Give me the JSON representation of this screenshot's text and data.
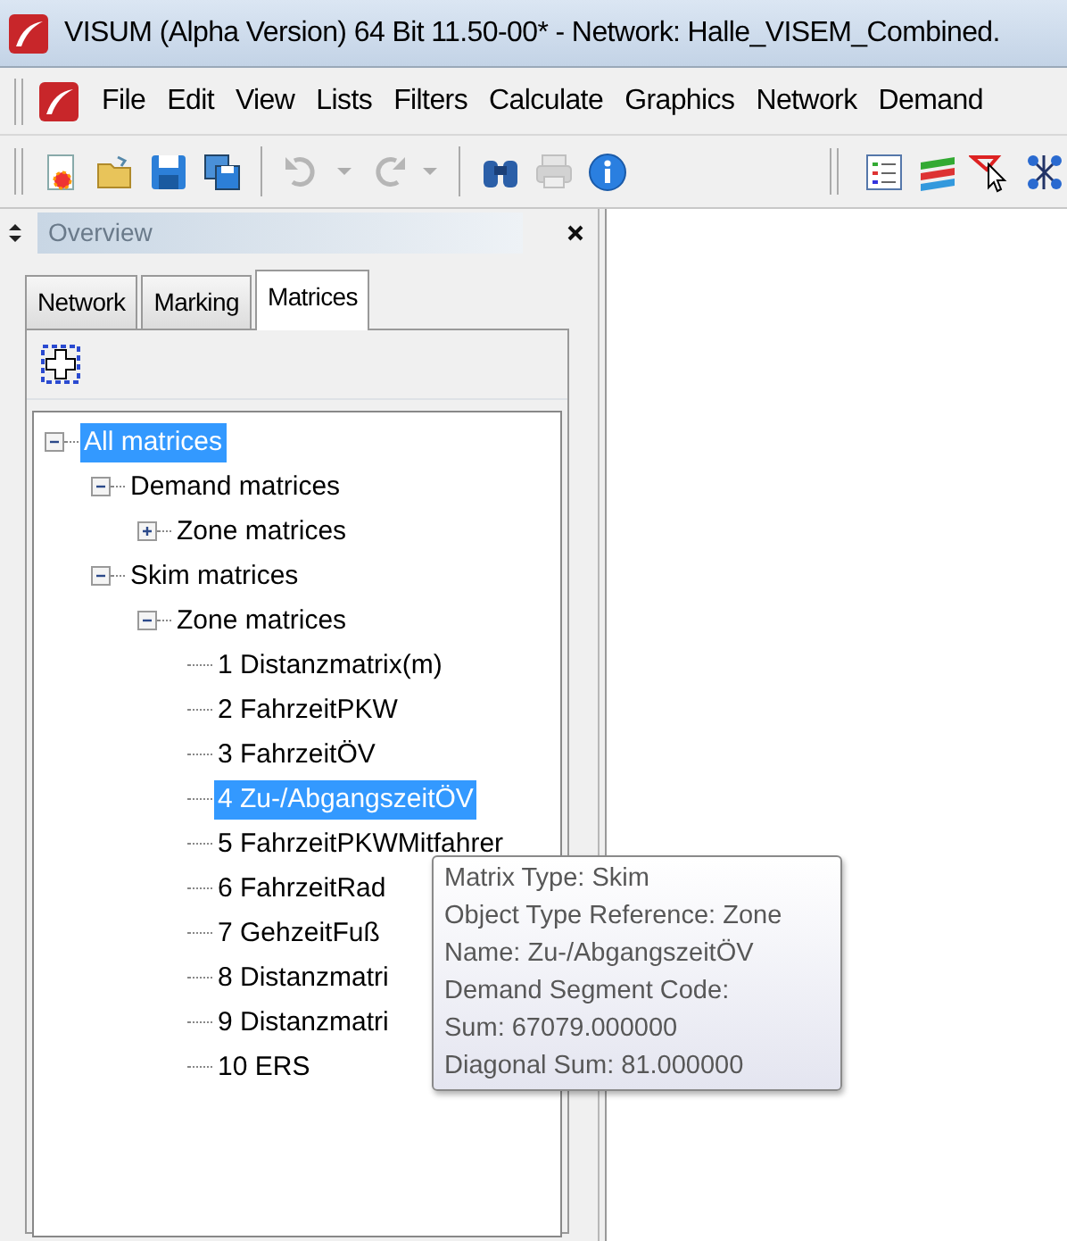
{
  "window": {
    "title": "VISUM (Alpha Version) 64 Bit 11.50-00* - Network: Halle_VISEM_Combined."
  },
  "menu": [
    {
      "label": "File"
    },
    {
      "label": "Edit"
    },
    {
      "label": "View"
    },
    {
      "label": "Lists"
    },
    {
      "label": "Filters"
    },
    {
      "label": "Calculate"
    },
    {
      "label": "Graphics"
    },
    {
      "label": "Network"
    },
    {
      "label": "Demand"
    }
  ],
  "toolbar": [
    {
      "kind": "new",
      "disabled": false
    },
    {
      "kind": "open",
      "disabled": false
    },
    {
      "kind": "save",
      "disabled": false
    },
    {
      "kind": "saveall",
      "disabled": false
    },
    {
      "kind": "sep"
    },
    {
      "kind": "undo",
      "disabled": true
    },
    {
      "kind": "caret",
      "disabled": true
    },
    {
      "kind": "redo",
      "disabled": true
    },
    {
      "kind": "caret",
      "disabled": true
    },
    {
      "kind": "sep"
    },
    {
      "kind": "find",
      "disabled": false
    },
    {
      "kind": "print",
      "disabled": true
    },
    {
      "kind": "info",
      "disabled": false
    },
    {
      "kind": "grip"
    },
    {
      "kind": "list",
      "disabled": false
    },
    {
      "kind": "layers",
      "disabled": false
    },
    {
      "kind": "filter",
      "disabled": false
    },
    {
      "kind": "graph",
      "disabled": false
    }
  ],
  "panel": {
    "title": "Overview",
    "tabs": [
      {
        "label": "Network",
        "selected": false
      },
      {
        "label": "Marking",
        "selected": false
      },
      {
        "label": "Matrices",
        "selected": true
      }
    ],
    "tree": [
      {
        "label": "All matrices",
        "expanded": true,
        "selected": true,
        "children": [
          {
            "label": "Demand matrices",
            "expanded": true,
            "selected": false,
            "children": [
              {
                "label": "Zone matrices",
                "expanded": false,
                "selected": false
              }
            ]
          },
          {
            "label": "Skim matrices",
            "expanded": true,
            "selected": false,
            "children": [
              {
                "label": "Zone matrices",
                "expanded": true,
                "selected": false,
                "children": [
                  {
                    "label": "1 Distanzmatrix(m)",
                    "selected": false
                  },
                  {
                    "label": "2 FahrzeitPKW",
                    "selected": false
                  },
                  {
                    "label": "3 FahrzeitÖV",
                    "selected": false
                  },
                  {
                    "label": "4 Zu-/AbgangszeitÖV",
                    "selected": true
                  },
                  {
                    "label": "5 FahrzeitPKWMitfahrer",
                    "selected": false
                  },
                  {
                    "label": "6 FahrzeitRad",
                    "selected": false
                  },
                  {
                    "label": "7 GehzeitFuß",
                    "selected": false
                  },
                  {
                    "label": "8 Distanzmatri",
                    "selected": false
                  },
                  {
                    "label": "9 Distanzmatri",
                    "selected": false
                  },
                  {
                    "label": "10 ERS",
                    "selected": false
                  }
                ]
              }
            ]
          }
        ]
      }
    ],
    "tooltip": [
      "Matrix Type: Skim",
      "Object Type Reference: Zone",
      "Name: Zu-/AbgangszeitÖV",
      "Demand Segment Code:",
      "Sum: 67079.000000",
      "Diagonal Sum: 81.000000"
    ]
  }
}
